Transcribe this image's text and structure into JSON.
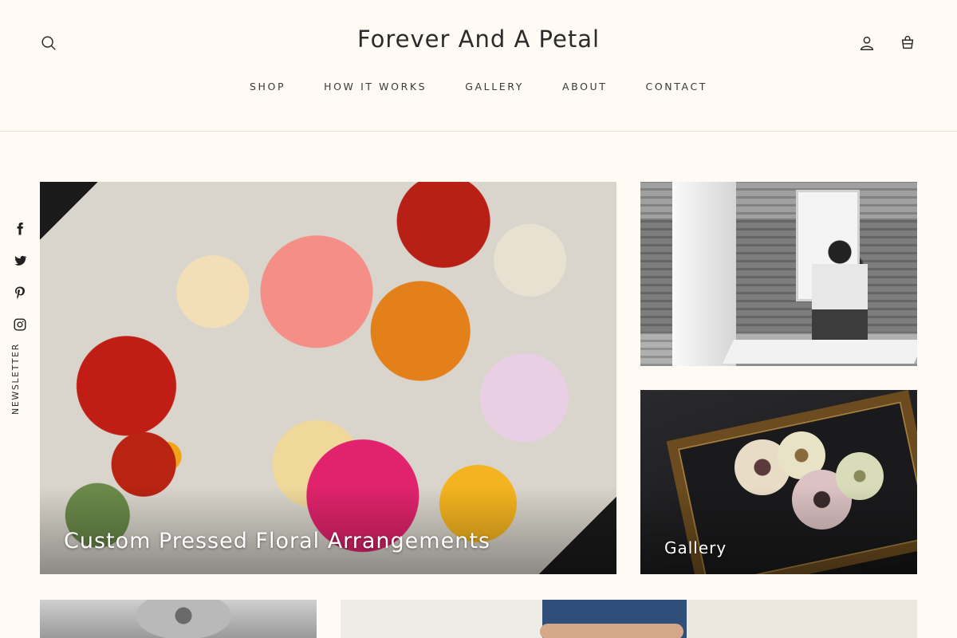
{
  "header": {
    "brand": "Forever And A Petal",
    "nav": [
      "SHOP",
      "HOW IT WORKS",
      "GALLERY",
      "ABOUT",
      "CONTACT"
    ],
    "icons": {
      "search": "search-icon",
      "account": "user-icon",
      "cart": "shopping-bag-icon"
    }
  },
  "social": {
    "icons": [
      "facebook-icon",
      "twitter-icon",
      "pinterest-icon",
      "instagram-icon"
    ],
    "newsletter_label": "NEWSLETTER"
  },
  "tiles": {
    "floral_label": "Custom Pressed Floral Arrangements",
    "gallery_label": "Gallery"
  },
  "colors": {
    "background": "#fffaf3",
    "text": "#2b2b2b",
    "divider": "#e7e1d8"
  }
}
